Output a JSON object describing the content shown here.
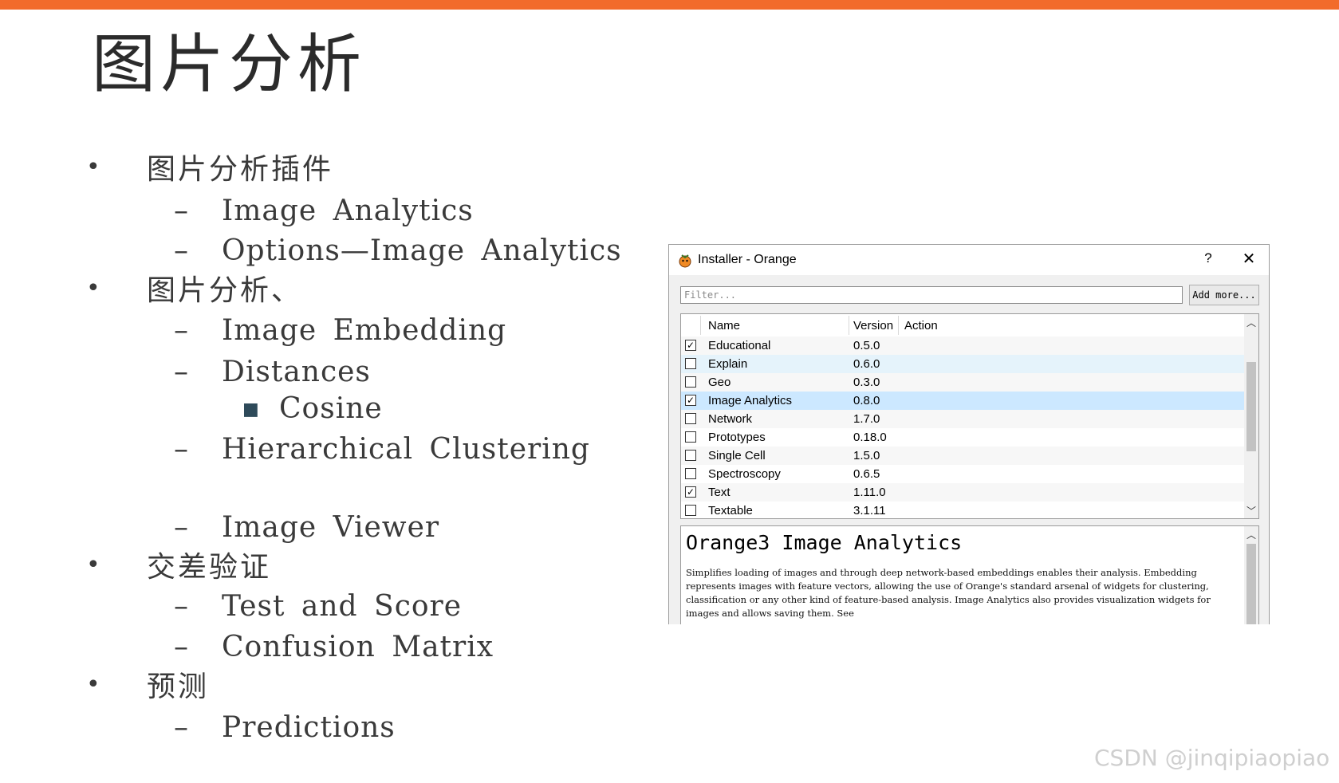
{
  "accent_color": "#f26b2b",
  "slide": {
    "title": "图片分析",
    "outline": [
      {
        "level": 1,
        "marker": "•",
        "text": "图片分析插件"
      },
      {
        "level": 2,
        "marker": "–",
        "text": "Image Analytics"
      },
      {
        "level": 2,
        "marker": "–",
        "text": "Options—Image Analytics"
      },
      {
        "level": 1,
        "marker": "•",
        "text": "图片分析、"
      },
      {
        "level": 2,
        "marker": "–",
        "text": "Image Embedding"
      },
      {
        "level": 2,
        "marker": "–",
        "text": "Distances"
      },
      {
        "level": 3,
        "marker": "■",
        "text": "Cosine"
      },
      {
        "level": 2,
        "marker": "–",
        "text": "Hierarchical Clustering"
      },
      {
        "level": 2,
        "marker": "–",
        "text": "Image Viewer"
      },
      {
        "level": 1,
        "marker": "•",
        "text": "交差验证"
      },
      {
        "level": 2,
        "marker": "–",
        "text": "Test and Score"
      },
      {
        "level": 2,
        "marker": "–",
        "text": "Confusion Matrix"
      },
      {
        "level": 1,
        "marker": "•",
        "text": "预测"
      },
      {
        "level": 2,
        "marker": "–",
        "text": "Predictions"
      }
    ]
  },
  "installer": {
    "title": "Installer - Orange",
    "help_label": "?",
    "close_label": "✕",
    "filter_placeholder": "Filter...",
    "add_more_label": "Add more...",
    "columns": {
      "name": "Name",
      "version": "Version",
      "action": "Action"
    },
    "packages": [
      {
        "name": "Educational",
        "version": "0.5.0",
        "checked": true
      },
      {
        "name": "Explain",
        "version": "0.6.0",
        "checked": false
      },
      {
        "name": "Geo",
        "version": "0.3.0",
        "checked": false
      },
      {
        "name": "Image Analytics",
        "version": "0.8.0",
        "checked": true
      },
      {
        "name": "Network",
        "version": "1.7.0",
        "checked": false
      },
      {
        "name": "Prototypes",
        "version": "0.18.0",
        "checked": false
      },
      {
        "name": "Single Cell",
        "version": "1.5.0",
        "checked": false
      },
      {
        "name": "Spectroscopy",
        "version": "0.6.5",
        "checked": false
      },
      {
        "name": "Text",
        "version": "1.11.0",
        "checked": true
      },
      {
        "name": "Textable",
        "version": "3.1.11",
        "checked": false
      }
    ],
    "selected_package": "Image Analytics",
    "hover_package": "Explain",
    "description_title": "Orange3 Image Analytics",
    "description_body": "Simplifies loading of images and through deep network-based embeddings enables their analysis. Embedding represents images with feature vectors, allowing the use of Orange's standard arsenal of widgets for clustering, classification or any other kind of feature-based analysis. Image Analytics also provides visualization widgets for images and allows saving them. See"
  },
  "watermark": "CSDN @jinqipiaopiao"
}
